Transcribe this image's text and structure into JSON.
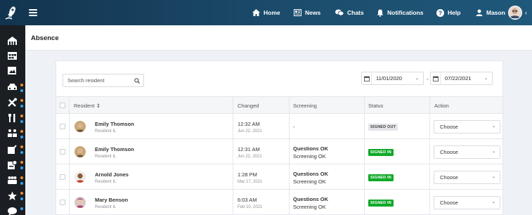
{
  "topbar": {
    "nav": [
      {
        "label": "Home",
        "icon": "home-icon"
      },
      {
        "label": "News",
        "icon": "news-icon"
      },
      {
        "label": "Chats",
        "icon": "chats-icon"
      },
      {
        "label": "Notifications",
        "icon": "bell-icon"
      },
      {
        "label": "Help",
        "icon": "help-icon"
      },
      {
        "label": "Mason",
        "icon": "user-icon"
      }
    ]
  },
  "page": {
    "title": "Absence"
  },
  "filters": {
    "search_placeholder": "Search resident",
    "date_from": "11/01/2020",
    "date_separator": "-",
    "date_to": "07/22/2021"
  },
  "table": {
    "headers": {
      "resident": "Resident",
      "sort_icon": "⇕",
      "changed": "Changed",
      "screening": "Screening",
      "status": "Status",
      "action": "Action"
    },
    "rows": [
      {
        "name": "Emily Thomson",
        "role": "Resident IL",
        "time": "12:32 AM",
        "date": "Jun 22, 2021",
        "screening1": "-",
        "screening2": "",
        "status": "SIGNED OUT",
        "status_type": "out",
        "action": "Choose"
      },
      {
        "name": "Emily Thomson",
        "role": "Resident IL",
        "time": "12:31 AM",
        "date": "Jun 22, 2021",
        "screening1": "Questions OK",
        "screening2": "Screening OK",
        "status": "SIGNED IN",
        "status_type": "in",
        "action": "Choose"
      },
      {
        "name": "Arnold Jones",
        "role": "Resident IL",
        "time": "1:28 PM",
        "date": "Mar 17, 2021",
        "screening1": "Questions OK",
        "screening2": "Screening OK",
        "status": "SIGNED IN",
        "status_type": "in",
        "action": "Choose"
      },
      {
        "name": "Mary Benson",
        "role": "Resident IL",
        "time": "6:03 AM",
        "date": "Feb 10, 2021",
        "screening1": "Questions OK",
        "screening2": "Screening OK",
        "status": "SIGNED IN",
        "status_type": "in",
        "action": "Choose"
      }
    ]
  },
  "colors": {
    "topbar": "#1c4c6c",
    "sidebar": "#1b1f24",
    "signed_in": "#10a928",
    "signed_out": "#e3e5e8",
    "dot_orange": "#f28c28",
    "dot_blue": "#2ea3f2"
  }
}
